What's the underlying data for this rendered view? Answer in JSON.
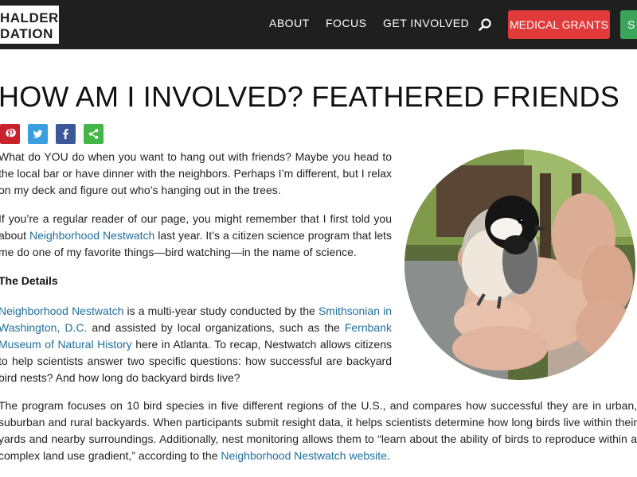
{
  "header": {
    "logo_line1": "HALDER",
    "logo_line2": "DATION",
    "nav": [
      "ABOUT",
      "FOCUS",
      "GET INVOLVED"
    ],
    "search_icon": "search-icon",
    "medical_grants_label": "MEDICAL GRANTS",
    "green_button_label": "S",
    "colors": {
      "bar": "#1f1f1f",
      "grants": "#e03a3a",
      "green": "#3aa55a"
    }
  },
  "article": {
    "title": "HOW AM I INVOLVED? FEATHERED FRIENDS",
    "share": [
      "pinterest-icon",
      "twitter-icon",
      "facebook-icon",
      "share-icon"
    ],
    "p1": "What do YOU do when you want to hang out with friends? Maybe you head to the local bar or have dinner with the neighbors. Perhaps I’m different, but I relax on my deck and figure out who’s hanging out in the trees.",
    "p2_before": "If you’re a regular reader of our page, you might remember that I first told you about ",
    "p2_link": "Neighborhood Nestwatch",
    "p2_after": " last year. It’s a citizen science program that lets me do one of my favorite things—bird watching—in the name of science.",
    "details_heading": "The Details",
    "p3_link1": "Neighborhood Nestwatch",
    "p3_text1": " is a multi-year study conducted by the ",
    "p3_link2": "Smithsonian in Washington, D.C.",
    "p3_text2": " and assisted by local organizations, such as the ",
    "p3_link3": "Fernbank Museum of Natural History",
    "p3_text3": " here in Atlanta. To recap, Nestwatch allows citizens to help scientists answer two specific questions: how successful are backyard bird nests? And how long do backyard birds live?",
    "p4_text": "The program focuses on 10 bird species in five different regions of the U.S., and compares how successful they are in urban, suburban and rural backyards. When participants submit resight data, it helps scientists determine how long birds live within their yards and nearby surroundings. Additionally, nest monitoring allows them to “learn about the ability of birds to reproduce within a complex land use gradient,” according to the ",
    "p4_link": "Neighborhood Nestwatch website",
    "p4_end": ".",
    "photo": "chickadee-in-hand-photo"
  }
}
